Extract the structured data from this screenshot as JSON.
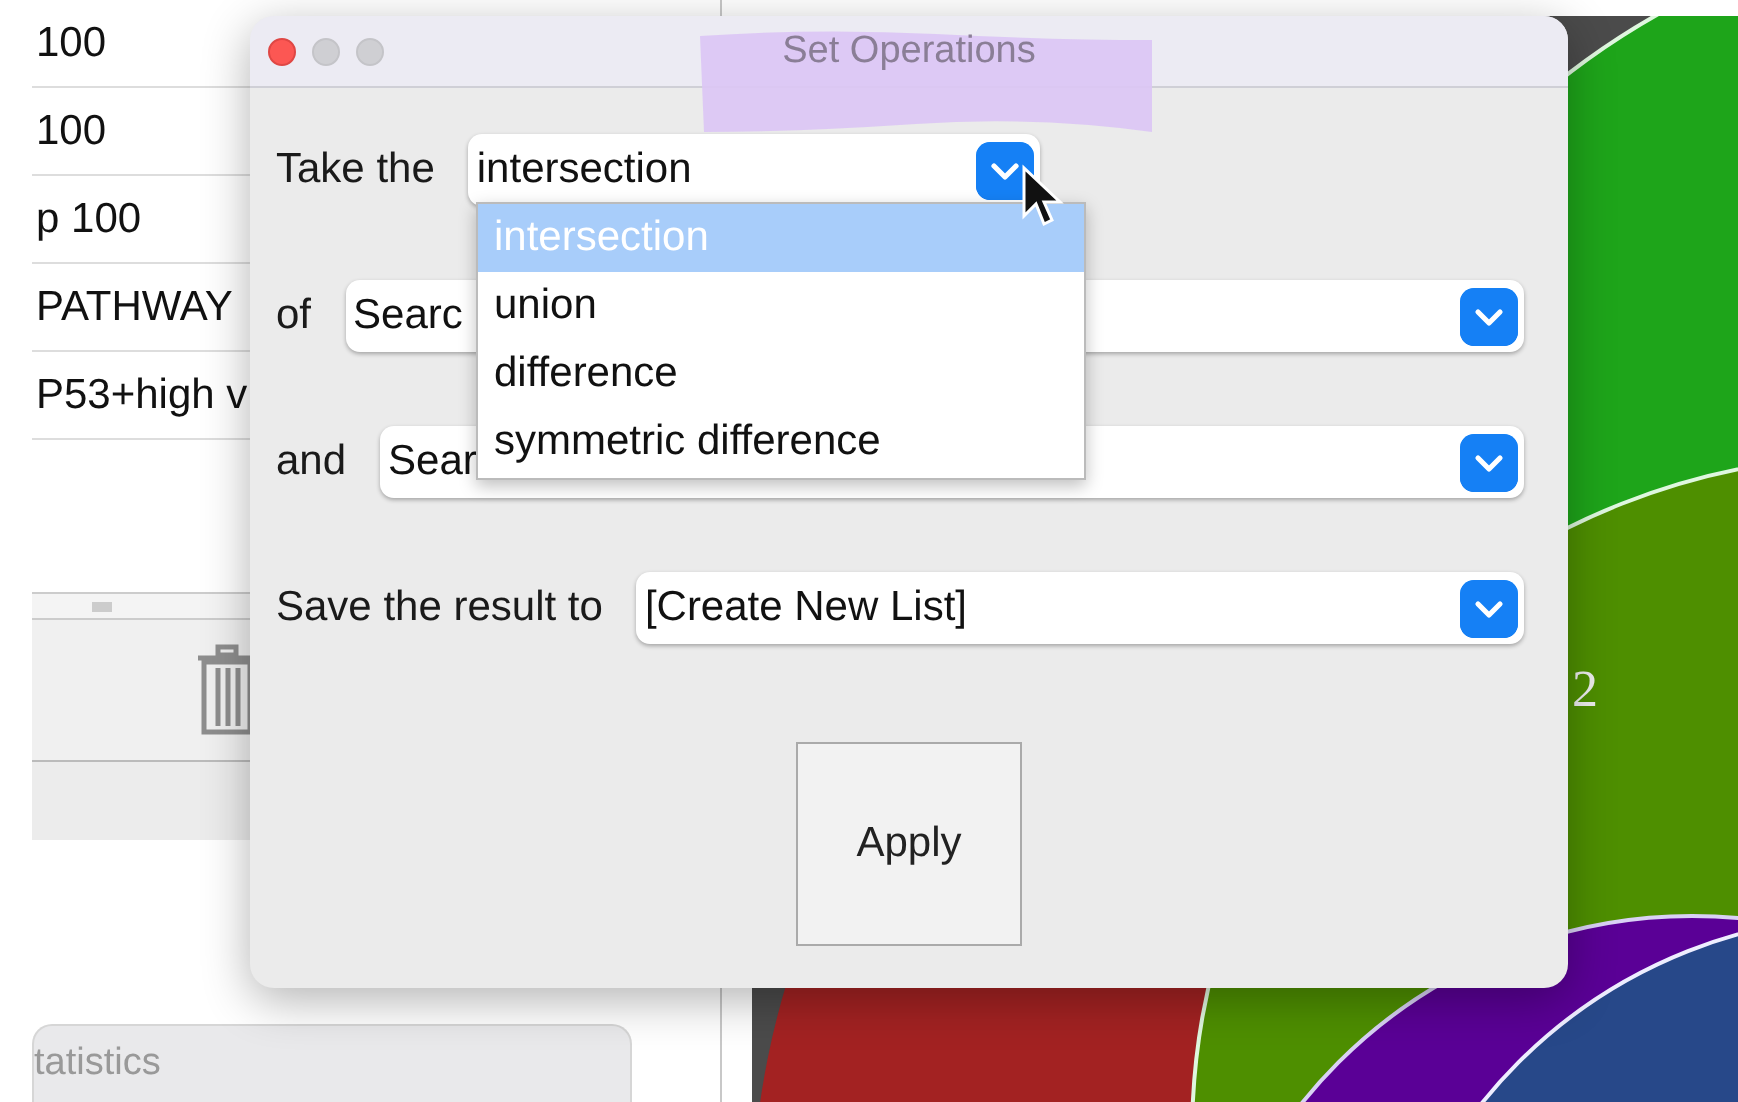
{
  "background_list": {
    "rows": [
      "100",
      "100",
      "p 100",
      "PATHWAY",
      "P53+high v"
    ]
  },
  "statistics_panel": {
    "title": "tatistics"
  },
  "venn_diagram": {
    "region_label": "2"
  },
  "dialog": {
    "title": "Set Operations",
    "rows": [
      {
        "label": "Take the",
        "value": "intersection",
        "kind": "short"
      },
      {
        "label": "of",
        "value": "Searc",
        "kind": "wide"
      },
      {
        "label": "and",
        "value": "Sear",
        "kind": "wide"
      },
      {
        "label": "Save the result to",
        "value": "[Create New List]",
        "kind": "wide"
      }
    ],
    "menu": {
      "items": [
        {
          "label": "intersection",
          "selected": true
        },
        {
          "label": "union",
          "selected": false
        },
        {
          "label": "difference",
          "selected": false
        },
        {
          "label": "symmetric difference",
          "selected": false
        }
      ]
    },
    "apply_button": "Apply"
  }
}
